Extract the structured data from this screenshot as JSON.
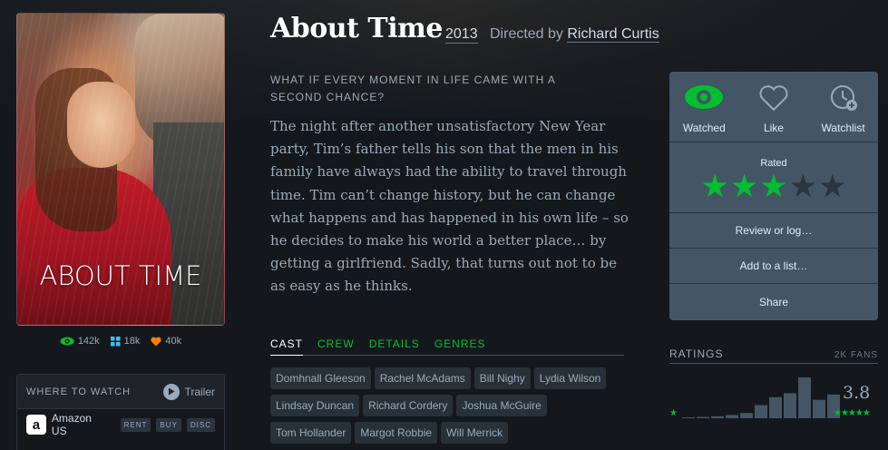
{
  "film": {
    "title": "About Time",
    "year": "2013",
    "directed_prefix": "Directed by",
    "director": "Richard Curtis",
    "tagline": "What if every moment in life came with a second chance?",
    "synopsis": "The night after another unsatisfactory New Year party, Tim’s father tells his son that the men in his family have always had the ability to travel through time. Tim can’t change history, but he can change what happens and has happened in his own life – so he decides to make his world a better place… by getting a girlfriend. Sadly, that turns out not to be as easy as he thinks."
  },
  "poster": {
    "title_text": "ABOUT TIME"
  },
  "stats": {
    "watched": "142k",
    "lists": "18k",
    "likes": "40k"
  },
  "where_to_watch": {
    "title": "WHERE TO WATCH",
    "trailer": "Trailer",
    "services": [
      {
        "name": "Amazon US",
        "options": [
          "RENT",
          "BUY",
          "DISC"
        ]
      }
    ]
  },
  "tabs": [
    "CAST",
    "CREW",
    "DETAILS",
    "GENRES"
  ],
  "active_tab": "CAST",
  "cast": [
    "Domhnall Gleeson",
    "Rachel McAdams",
    "Bill Nighy",
    "Lydia Wilson",
    "Lindsay Duncan",
    "Richard Cordery",
    "Joshua McGuire",
    "Tom Hollander",
    "Margot Robbie",
    "Will Merrick"
  ],
  "actions": {
    "watched": "Watched",
    "like": "Like",
    "watchlist": "Watchlist",
    "rated_label": "Rated",
    "rating_stars": 3,
    "rating_max": 5,
    "review": "Review or log…",
    "add_list": "Add to a list…",
    "share": "Share"
  },
  "ratings": {
    "title": "RATINGS",
    "fans": "2K FANS",
    "average": "3.8",
    "histogram": [
      1,
      2,
      3,
      5,
      8,
      20,
      32,
      38,
      62,
      28,
      36
    ]
  },
  "colors": {
    "accent_green": "#00c030",
    "like_orange": "#ff8000",
    "list_blue": "#40bcf4",
    "panel": "#445566",
    "background": "#14181c"
  }
}
